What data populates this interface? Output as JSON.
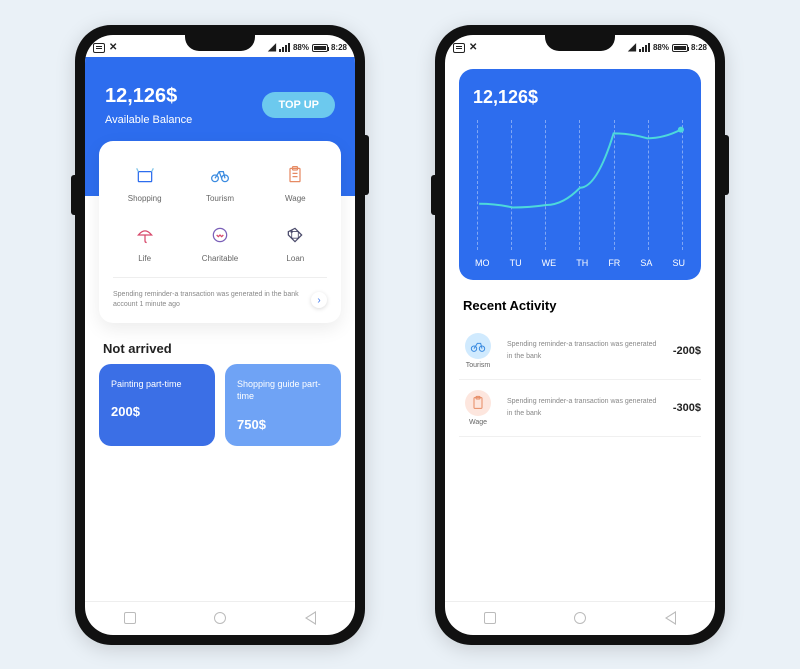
{
  "status": {
    "battery": "88%",
    "time": "8:28"
  },
  "screen1": {
    "balance": "12,126$",
    "balance_label": "Available Balance",
    "topup": "TOP UP",
    "categories": [
      {
        "label": "Shopping",
        "icon": "shopping"
      },
      {
        "label": "Tourism",
        "icon": "tourism"
      },
      {
        "label": "Wage",
        "icon": "wage"
      },
      {
        "label": "Life",
        "icon": "life"
      },
      {
        "label": "Charitable",
        "icon": "charitable"
      },
      {
        "label": "Loan",
        "icon": "loan"
      }
    ],
    "reminder": "Spending reminder-a transaction was generated in the bank account 1 minute ago",
    "not_arrived_title": "Not arrived",
    "cards": [
      {
        "title": "Painting part-time",
        "amount": "200$"
      },
      {
        "title": "Shopping guide part-time",
        "amount": "750$"
      }
    ]
  },
  "screen2": {
    "balance": "12,126$",
    "days": [
      "MO",
      "TU",
      "WE",
      "TH",
      "FR",
      "SA",
      "SU"
    ],
    "recent_title": "Recent Activity",
    "activities": [
      {
        "icon": "tourism",
        "category": "Tourism",
        "text": "Spending reminder-a transaction was generated in the bank",
        "amount": "-200$"
      },
      {
        "icon": "wage",
        "category": "Wage",
        "text": "Spending reminder-a transaction was generated in the bank",
        "amount": "-300$"
      }
    ]
  },
  "chart_data": {
    "type": "line",
    "title": "12,126$",
    "categories": [
      "MO",
      "TU",
      "WE",
      "TH",
      "FR",
      "SA",
      "SU"
    ],
    "values": [
      35,
      32,
      34,
      48,
      92,
      88,
      95
    ],
    "ylim": [
      0,
      100
    ],
    "xlabel": "",
    "ylabel": ""
  }
}
